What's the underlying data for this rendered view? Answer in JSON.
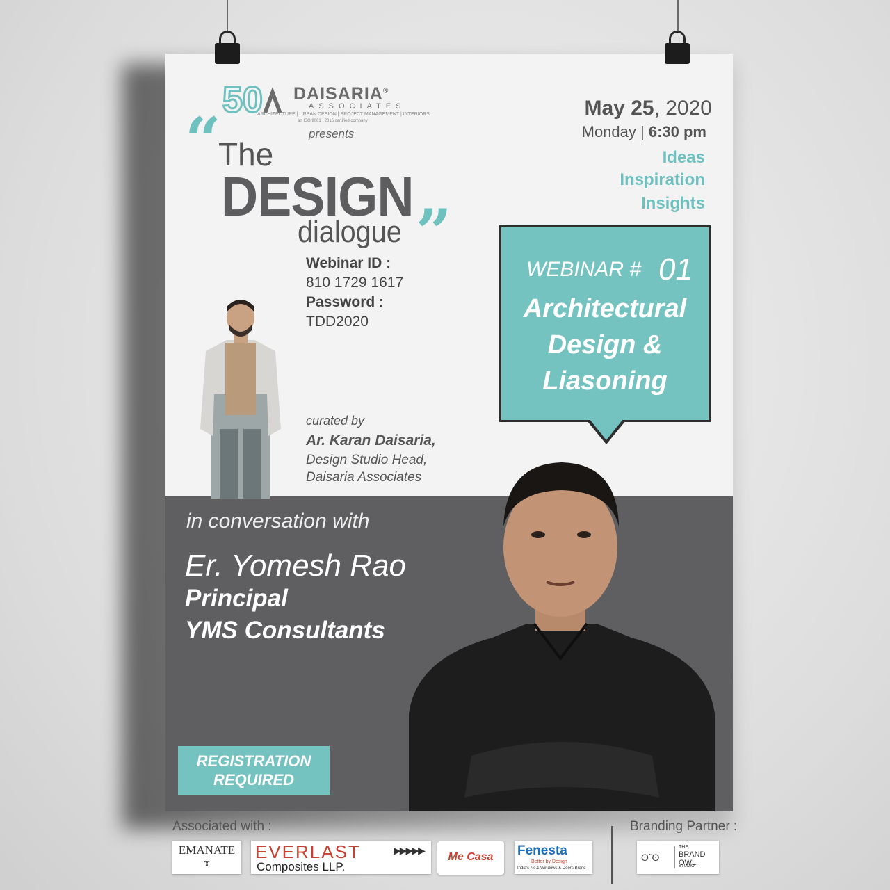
{
  "logo": {
    "brand": "DAISARIA",
    "reg_mark": "®",
    "sub": "ASSOCIATES",
    "tagline": "ARCHITECTURE | URBAN DESIGN | PROJECT MANAGEMENT | INTERIORS",
    "iso": "an ISO 9001 : 2015 certified company",
    "presents": "presents"
  },
  "title": {
    "the": "The",
    "design": "DESIGN",
    "dialogue": "dialogue",
    "quote_open": "“",
    "quote_close": "”"
  },
  "access": {
    "webinar_id_label": "Webinar ID :",
    "webinar_id": "810 1729 1617",
    "password_label": "Password :",
    "password": "TDD2020"
  },
  "event": {
    "date_bold": "May 25",
    "date_rest": ", 2020",
    "day": "Monday | ",
    "time": "6:30 pm",
    "tags": [
      "Ideas",
      "Inspiration",
      "Insights"
    ]
  },
  "webinar": {
    "label": "WEBINAR  #",
    "number": "01",
    "topic_lines": [
      "Architectural",
      "Design &",
      "Liasoning"
    ]
  },
  "curator": {
    "label": "curated by",
    "name": "Ar. Karan Daisaria,",
    "role_lines": [
      "Design Studio Head,",
      "Daisaria Associates"
    ]
  },
  "guest": {
    "intro": "in conversation with",
    "name": "Er. Yomesh Rao",
    "title_lines": [
      "Principal",
      "YMS Consultants"
    ]
  },
  "registration": {
    "lines": [
      "REGISTRATION",
      "REQUIRED"
    ]
  },
  "footer": {
    "associated_label": "Associated with :",
    "branding_label": "Branding Partner :",
    "partners": {
      "emanate": "EMANATE",
      "everlast": "EVERLAST",
      "everlast_sub": "Composites LLP.",
      "mecasa": "Me Casa",
      "fenesta": "Fenesta",
      "fenesta_tag": "Better by Design",
      "fenesta_sub": "India's No.1 Windows & Doors Brand",
      "owl_the": "THE",
      "owl_name": "BRAND OWL",
      "owl_studio": "STUDIO"
    }
  },
  "colors": {
    "teal": "#74c3c0",
    "dark_panel": "#5f5f61",
    "poster_bg": "#f3f3f3"
  }
}
